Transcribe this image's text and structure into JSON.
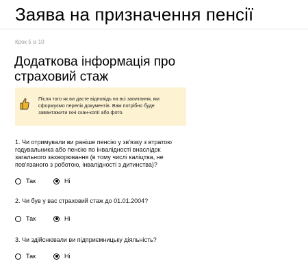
{
  "page": {
    "title": "Заява на призначення пенсії",
    "step": "Крок 5 із 10",
    "section_title_line1": "Додаткова інформація про",
    "section_title_line2": "страховий стаж"
  },
  "notice": {
    "icon": "thumbs-up-icon",
    "text": "Після того як ви дасте відповідь на всі запитання, ми сформуємо перелік документів. Вам потрібно буде завантажити їхні скан-копії або фото.",
    "background": "#fdf3d3",
    "icon_color": "#f0b429"
  },
  "questions": [
    {
      "text": "1. Чи отримували ви раніше пенсію у зв'язку з втратою годувальника або пенсію по інвалідності внаслідок загального захворювання (в тому числі каліцтва, не пов'язаного з роботою, інвалідності з дитинства)?",
      "options": [
        "Так",
        "Ні"
      ],
      "selected": "Ні"
    },
    {
      "text": "2. Чи був у вас страховий стаж до 01.01.2004?",
      "options": [
        "Так",
        "Ні"
      ],
      "selected": "Ні"
    },
    {
      "text": "3. Чи здійснювали ви підприємницьку діяльність?",
      "options": [
        "Так",
        "Ні"
      ],
      "selected": "Ні"
    }
  ]
}
